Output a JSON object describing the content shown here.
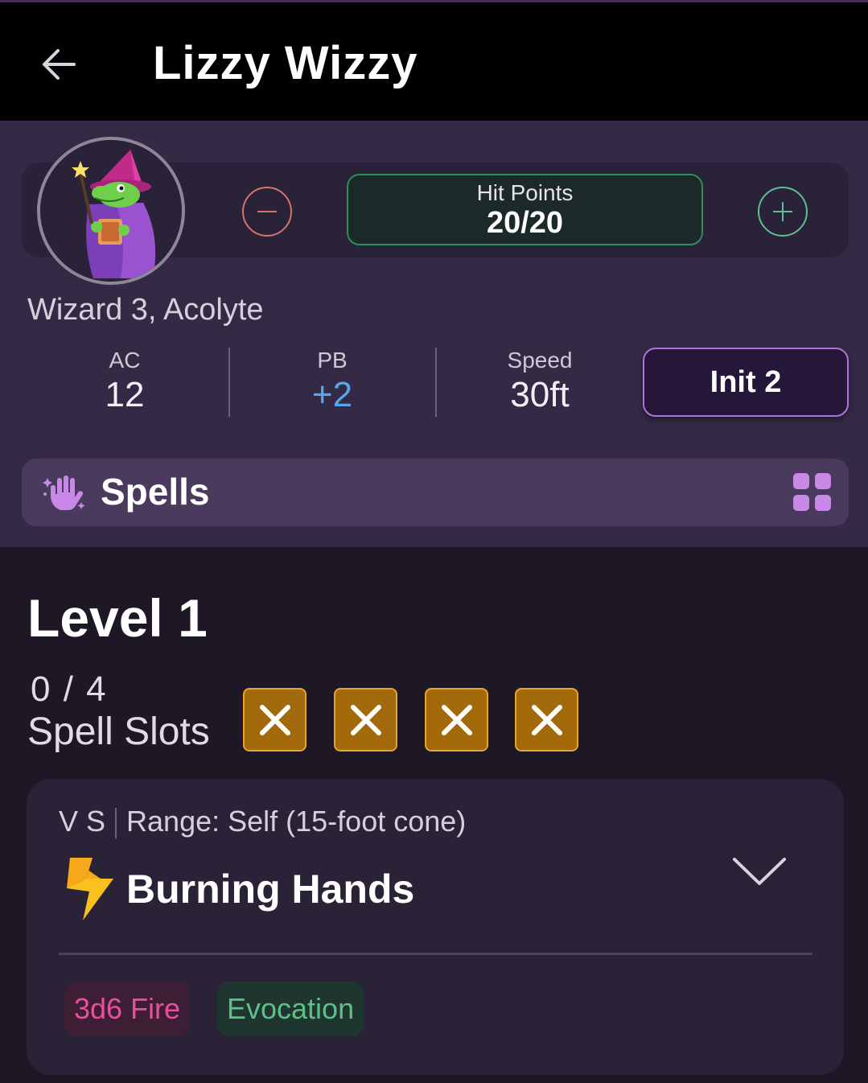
{
  "header": {
    "title": "Lizzy Wizzy",
    "back_icon": "arrow-left-icon"
  },
  "character": {
    "class_line": "Wizard 3, Acolyte",
    "hit_points": {
      "label": "Hit Points",
      "value": "20/20"
    },
    "stats": {
      "ac": {
        "label": "AC",
        "value": "12"
      },
      "pb": {
        "label": "PB",
        "value": "+2"
      },
      "speed": {
        "label": "Speed",
        "value": "30ft"
      }
    },
    "initiative_label": "Init 2"
  },
  "spells_bar": {
    "title": "Spells",
    "icon": "magic-hand-icon",
    "view_icon": "grid-icon"
  },
  "level": {
    "title": "Level 1",
    "slot_count": "0 / 4",
    "slot_label": "Spell Slots",
    "slots_used": 4,
    "slots_total": 4
  },
  "spell": {
    "components": "V S",
    "range": "Range: Self (15-foot cone)",
    "name": "Burning Hands",
    "damage_tag": "3d6 Fire",
    "school_tag": "Evocation"
  },
  "colors": {
    "background": "#1d1726",
    "panel": "#342a45",
    "accent_purple": "#b073d9",
    "hp_green": "#2f8f5c",
    "slot_gold": "#a26a0b",
    "damage_pink": "#e84f9c",
    "school_green": "#5fbf88"
  }
}
